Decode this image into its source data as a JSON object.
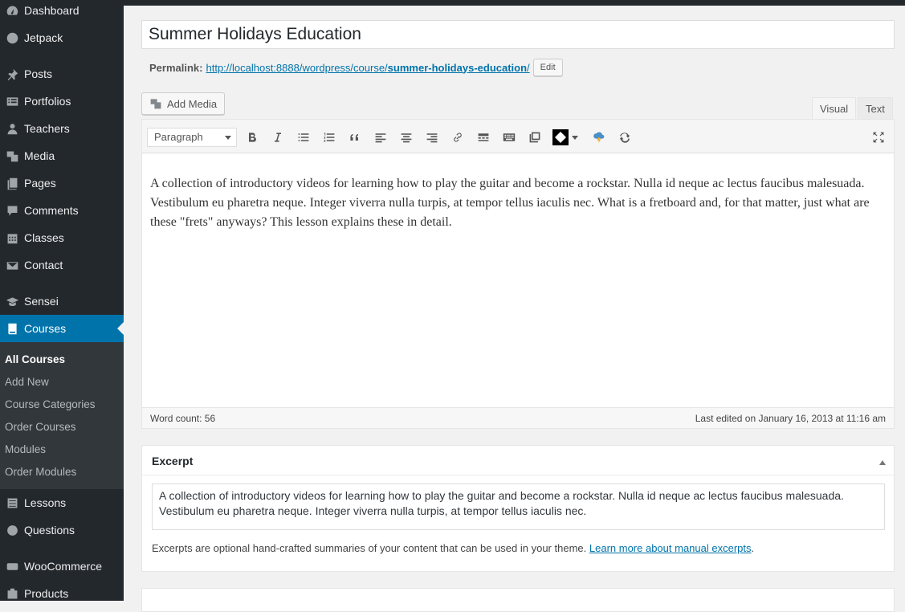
{
  "sidebar": {
    "items": [
      {
        "label": "Dashboard",
        "icon": "dashboard-icon"
      },
      {
        "label": "Jetpack",
        "icon": "jetpack-icon"
      },
      {
        "label": "Posts",
        "icon": "pin-icon"
      },
      {
        "label": "Portfolios",
        "icon": "portfolio-icon"
      },
      {
        "label": "Teachers",
        "icon": "users-icon"
      },
      {
        "label": "Media",
        "icon": "media-icon"
      },
      {
        "label": "Pages",
        "icon": "pages-icon"
      },
      {
        "label": "Comments",
        "icon": "comment-icon"
      },
      {
        "label": "Classes",
        "icon": "calendar-icon"
      },
      {
        "label": "Contact",
        "icon": "mail-icon"
      },
      {
        "label": "Sensei",
        "icon": "graduation-cap-icon"
      },
      {
        "label": "Courses",
        "icon": "book-icon"
      },
      {
        "label": "Lessons",
        "icon": "list-icon"
      },
      {
        "label": "Questions",
        "icon": "help-icon"
      },
      {
        "label": "WooCommerce",
        "icon": "woo-icon"
      },
      {
        "label": "Products",
        "icon": "products-icon"
      }
    ],
    "submenu": [
      "All Courses",
      "Add New",
      "Course Categories",
      "Order Courses",
      "Modules",
      "Order Modules"
    ]
  },
  "post": {
    "title": "Summer Holidays Education",
    "permalink_label": "Permalink:",
    "permalink_base": "http://localhost:8888/wordpress/course/",
    "permalink_slug": "summer-holidays-education",
    "permalink_tail": "/",
    "edit_label": "Edit"
  },
  "editor": {
    "add_media": "Add Media",
    "tab_visual": "Visual",
    "tab_text": "Text",
    "format": "Paragraph",
    "content": "A collection of introductory videos for learning how to play the guitar and become a rockstar. Nulla id neque ac lectus faucibus malesuada. Vestibulum eu pharetra neque. Integer viverra nulla turpis, at tempor tellus iaculis nec.  What is a fretboard and, for that matter, just what are these \"frets\" anyways? This lesson explains these in detail.",
    "word_count": "Word count: 56",
    "last_edited": "Last edited on January 16, 2013 at 11:16 am"
  },
  "excerpt": {
    "title": "Excerpt",
    "text": "A collection of introductory videos for learning how to play the guitar and become a rockstar. Nulla id neque ac lectus faucibus malesuada. Vestibulum eu pharetra neque. Integer viverra nulla turpis, at tempor tellus iaculis nec.",
    "help": "Excerpts are optional hand-crafted summaries of your content that can be used in your theme.",
    "link": "Learn more about manual excerpts",
    "help_end": "."
  }
}
